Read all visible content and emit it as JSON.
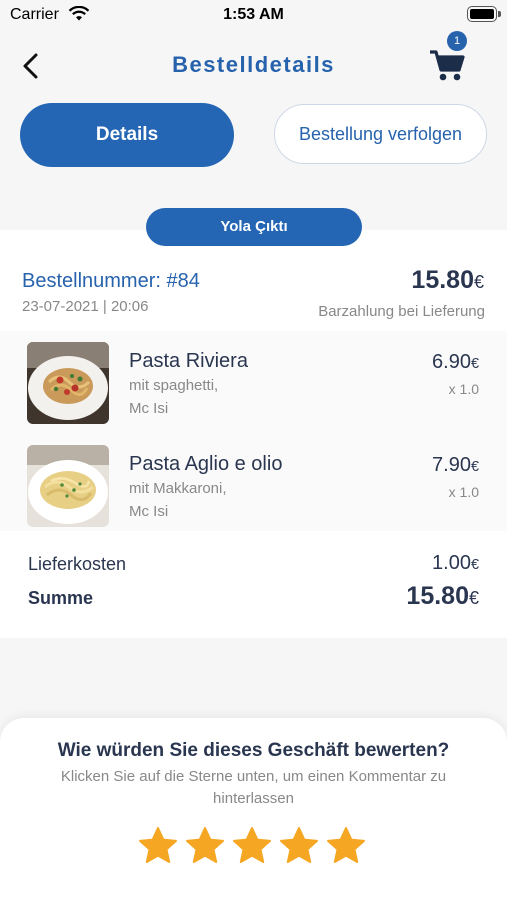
{
  "status_bar": {
    "carrier": "Carrier",
    "time": "1:53 AM"
  },
  "nav": {
    "title": "Bestelldetails",
    "cart_count": "1"
  },
  "tabs": {
    "details": "Details",
    "track": "Bestellung verfolgen"
  },
  "order": {
    "status": "Yola Çıktı",
    "number": "Bestellnummer: #84",
    "date": "23-07-2021 | 20:06",
    "total": "15.80",
    "currency": "€",
    "payment": "Barzahlung bei Lieferung"
  },
  "items": [
    {
      "name": "Pasta Riviera",
      "desc_line1": "mit spaghetti,",
      "desc_line2": "Mc Isi",
      "price": "6.90",
      "qty": "x 1.0"
    },
    {
      "name": "Pasta Aglio e olio",
      "desc_line1": "mit Makkaroni,",
      "desc_line2": "Mc Isi",
      "price": "7.90",
      "qty": "x 1.0"
    }
  ],
  "summary": {
    "delivery_label": "Lieferkosten",
    "delivery_value": "1.00",
    "sum_label": "Summe",
    "sum_value": "15.80"
  },
  "rating": {
    "question": "Wie würden Sie dieses Geschäft bewerten?",
    "subtitle": "Klicken Sie auf die Sterne unten, um einen Kommentar zu hinterlassen",
    "stars": 5
  },
  "colors": {
    "primary": "#2466b4",
    "star": "#f5a623",
    "text": "#2a3650"
  }
}
